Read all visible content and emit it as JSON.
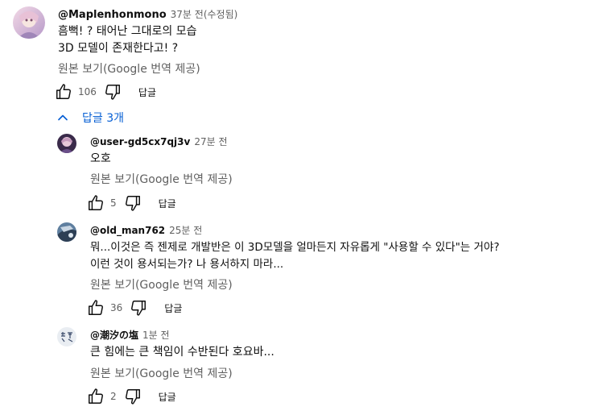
{
  "top_comment": {
    "author": "@Maplenhonmono",
    "time": "37분 전(수정됨)",
    "lines": [
      "흠뻑! ? 태어난 그대로의 모습",
      "3D 모델이 존재한다고! ?"
    ],
    "translate": "원본 보기(Google 번역 제공)",
    "likes": "106",
    "reply_label": "답글"
  },
  "replies_toggle": {
    "label": "답글 3개"
  },
  "replies": [
    {
      "author": "@user-gd5cx7qj3v",
      "time": "27분 전",
      "lines": [
        "오호"
      ],
      "translate": "원본 보기(Google 번역 제공)",
      "likes": "5",
      "reply_label": "답글"
    },
    {
      "author": "@old_man762",
      "time": "25분 전",
      "lines": [
        "뭐...이것은 즉 젠제로 개발반은 이 3D모델을 얼마든지 자유롭게 \"사용할 수 있다\"는 거야?",
        "이런 것이 용서되는가? 나 용서하지 마라..."
      ],
      "translate": "원본 보기(Google 번역 제공)",
      "likes": "36",
      "reply_label": "답글"
    },
    {
      "author": "@潮汐の塩",
      "time": "1분 전",
      "lines": [
        "큰 힘에는 큰 책임이 수반된다 호요바..."
      ],
      "translate": "원본 보기(Google 번역 제공)",
      "likes": "2",
      "reply_label": "답글"
    }
  ],
  "icons": {
    "like": "thumb-up-icon",
    "dislike": "thumb-down-icon",
    "collapse": "chevron-up-icon"
  },
  "colors": {
    "link_blue": "#065fd4",
    "secondary_text": "#606060",
    "primary_text": "#0f0f0f"
  }
}
